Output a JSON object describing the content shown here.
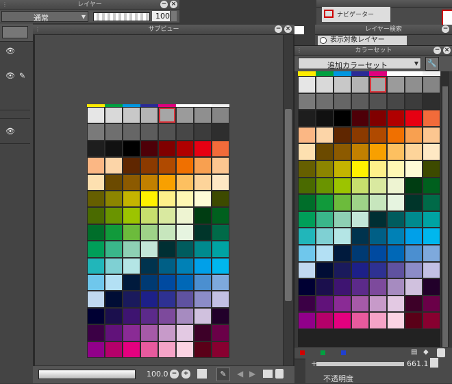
{
  "layer_panel": {
    "title": "レイヤー",
    "blend_mode": "通常",
    "opacity": "100"
  },
  "subview": {
    "title": "サブビュー",
    "zoom": "100.0"
  },
  "navigator": {
    "title": "ナビゲーター"
  },
  "layer_search": {
    "title": "レイヤー検索",
    "filter": "表示対象レイヤー"
  },
  "color_set": {
    "title": "カラーセット",
    "set_name": "追加カラーセット"
  },
  "property": {
    "brush_size": "661.1",
    "opacity_label": "不透明度"
  },
  "palette_rows": [
    [
      "#ffeb00",
      "#00a040",
      "#0096e0",
      "#2a2a96",
      "#e0007e",
      "#ffffff",
      "#ffffff",
      "#f0f0f0"
    ],
    [
      "#e6e6e6",
      "#d9d9d9",
      "#c8c8c8",
      "#b4b4b4",
      "#a6a6a6",
      "#9b9b9b",
      "#8f8f8f",
      "#858585"
    ],
    [
      "#7a7a7a",
      "#6f6f6f",
      "#666666",
      "#5c5c5c",
      "#525252",
      "#474747",
      "#3c3c3c",
      "#2e2e2e"
    ],
    [
      "#1e1e1e",
      "#111111",
      "#000000",
      "#4e0008",
      "#800000",
      "#b00000",
      "#e60012",
      "#f26b3a"
    ],
    [
      "#fbb784",
      "#fcd5a8",
      "#5f2600",
      "#8b3a00",
      "#b04a00",
      "#f07000",
      "#f8a050",
      "#fcc690"
    ],
    [
      "#fde0b0",
      "#6b4a00",
      "#8c5a00",
      "#c28000",
      "#f8a000",
      "#fdc060",
      "#fdd49a",
      "#fee8c4"
    ],
    [
      "#665f00",
      "#8c8500",
      "#c4b400",
      "#fff100",
      "#fef08a",
      "#fff7b4",
      "#fffbd6",
      "#3d4a00"
    ],
    [
      "#4a6a00",
      "#6a9400",
      "#9cc400",
      "#c7df6d",
      "#d9e9a0",
      "#eef4d2",
      "#003d12",
      "#00601e"
    ],
    [
      "#006e2a",
      "#119a3b",
      "#6cbb3c",
      "#9ed288",
      "#c7e6bd",
      "#e6f4e0",
      "#00352a",
      "#006a48"
    ],
    [
      "#009e59",
      "#3ab68a",
      "#8ed0b4",
      "#c4e6d8",
      "#002f33",
      "#005c5e",
      "#008a8e",
      "#00a3a3"
    ],
    [
      "#21b6ba",
      "#7fd0d3",
      "#b4e5e5",
      "#00334e",
      "#005f86",
      "#0081b6",
      "#00a0e9",
      "#00b7ee"
    ],
    [
      "#6fc7ec",
      "#b3e0f4",
      "#001a3d",
      "#003a73",
      "#004aa0",
      "#0068b7",
      "#4b8fd0",
      "#7ea9dc"
    ],
    [
      "#c0d8f0",
      "#000d35",
      "#1a1a5c",
      "#1d2088",
      "#2e3192",
      "#5f52a0",
      "#8c8cc8",
      "#c2c0e4"
    ],
    [
      "#000033",
      "#1b0f4d",
      "#3e1471",
      "#5c2a8a",
      "#7d4a9c",
      "#a68bc0",
      "#d0c1de",
      "#22002a"
    ],
    [
      "#3b0045",
      "#61127a",
      "#8a2b95",
      "#a65aa8",
      "#c79ac9",
      "#e3c9e3",
      "#3d0028",
      "#6a0048"
    ],
    [
      "#91008a",
      "#b5006a",
      "#e4007f",
      "#e85a9e",
      "#f5a3c7",
      "#fbd3e3",
      "#5a0018",
      "#880030"
    ]
  ],
  "icons": [
    "wrench-icon",
    "settings-icon",
    "zoom-in-icon",
    "zoom-out-icon",
    "eye-icon",
    "pen-icon",
    "fill-icon",
    "trash-icon"
  ]
}
